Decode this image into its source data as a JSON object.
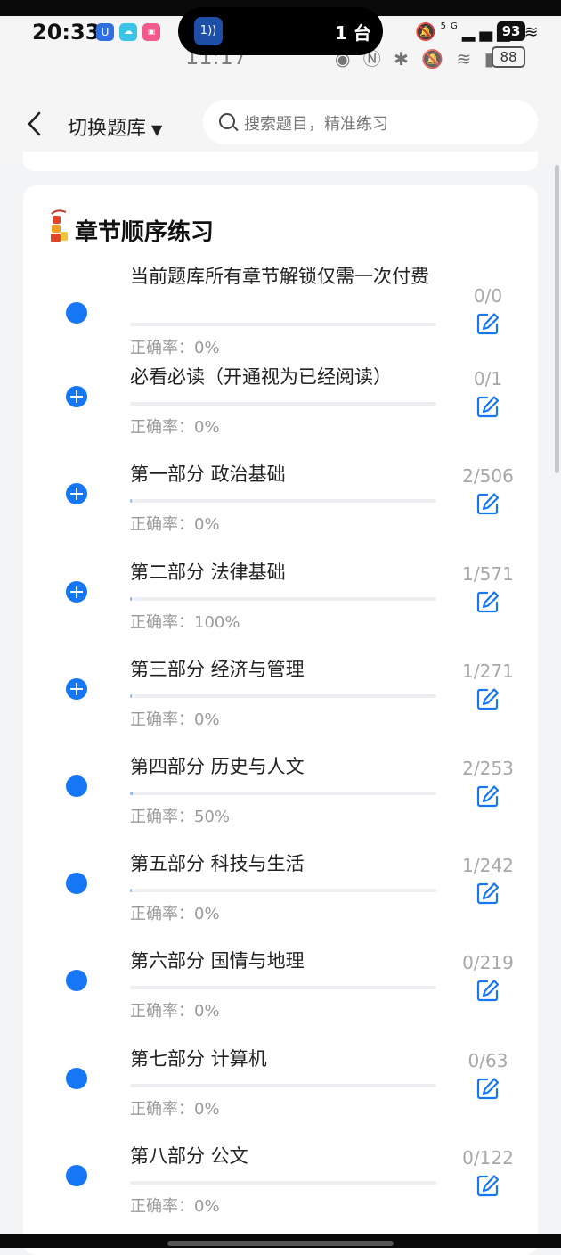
{
  "status_bar": {
    "time": "20:33",
    "ghost_time": "11:17",
    "island_text": "1 台",
    "island_icon_label": "1",
    "battery": "93",
    "ghost_battery": "88",
    "network": "5G"
  },
  "colors": {
    "accent": "#1577f5",
    "progress": "#8bb8f6"
  },
  "header": {
    "back_icon": "chevron-left-icon",
    "switch_label": "切换题库",
    "search_placeholder": "搜索题目，精准练习"
  },
  "section": {
    "title": "章节顺序练习",
    "icon": "firecracker-icon"
  },
  "chapters": [
    {
      "name": "当前题库所有章节解锁仅需一次付费",
      "rate": "正确率：0%",
      "count": "0/0",
      "progress": 0,
      "expandable": false
    },
    {
      "name": "必看必读（开通视为已经阅读）",
      "rate": "正确率：0%",
      "count": "0/1",
      "progress": 0,
      "expandable": true
    },
    {
      "name": "第一部分 政治基础",
      "rate": "正确率：0%",
      "count": "2/506",
      "progress": 0.004,
      "expandable": true
    },
    {
      "name": "第二部分 法律基础",
      "rate": "正确率：100%",
      "count": "1/571",
      "progress": 0.002,
      "expandable": true
    },
    {
      "name": "第三部分 经济与管理",
      "rate": "正确率：0%",
      "count": "1/271",
      "progress": 0.004,
      "expandable": true
    },
    {
      "name": "第四部分 历史与人文",
      "rate": "正确率：50%",
      "count": "2/253",
      "progress": 0.008,
      "expandable": false
    },
    {
      "name": "第五部分 科技与生活",
      "rate": "正确率：0%",
      "count": "1/242",
      "progress": 0.004,
      "expandable": false
    },
    {
      "name": "第六部分 国情与地理",
      "rate": "正确率：0%",
      "count": "0/219",
      "progress": 0,
      "expandable": false
    },
    {
      "name": "第七部分 计算机",
      "rate": "正确率：0%",
      "count": "0/63",
      "progress": 0,
      "expandable": false
    },
    {
      "name": "第八部分 公文",
      "rate": "正确率：0%",
      "count": "0/122",
      "progress": 0,
      "expandable": false
    }
  ]
}
